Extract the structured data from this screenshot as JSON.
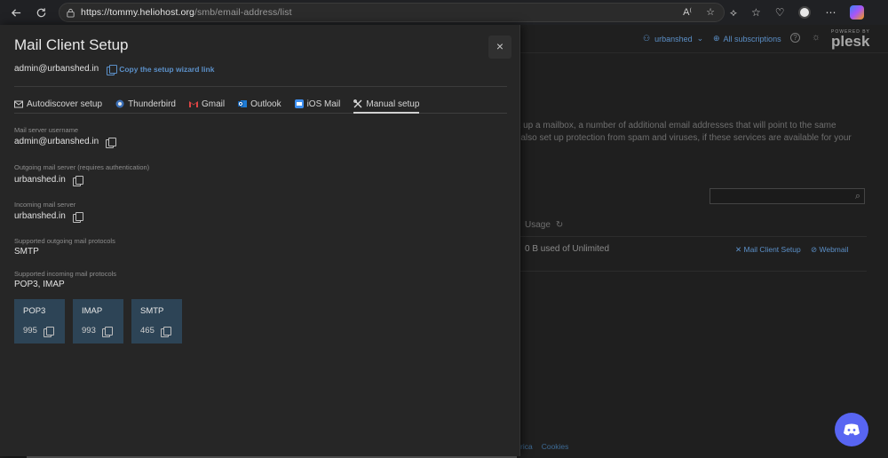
{
  "browser": {
    "url_host": "https://tommy.heliohost.org",
    "url_path": "/smb/email-address/list"
  },
  "plesk": {
    "user": "urbanshed",
    "subscriptions": "All subscriptions",
    "powered_by": "POWERED BY",
    "logo": "plesk",
    "description_line1": "et up a mailbox, a number of additional email addresses that will point to the same",
    "description_line2": "n also set up protection from spam and viruses, if these services are available for your",
    "usage_header": "Usage",
    "usage_value": "0 B used of Unlimited",
    "mail_client_setup": "Mail Client Setup",
    "webmail": "Webmail",
    "footer_a": "rica",
    "footer_b": "Cookies"
  },
  "modal": {
    "title": "Mail Client Setup",
    "close": "×",
    "account": "admin@urbanshed.in",
    "copy_wizard_link": "Copy the setup wizard link",
    "tabs": [
      {
        "label": "Autodiscover setup",
        "icon": "envelope-icon"
      },
      {
        "label": "Thunderbird",
        "icon": "thunderbird-icon"
      },
      {
        "label": "Gmail",
        "icon": "gmail-icon"
      },
      {
        "label": "Outlook",
        "icon": "outlook-icon"
      },
      {
        "label": "iOS Mail",
        "icon": "ios-mail-icon"
      },
      {
        "label": "Manual setup",
        "icon": "tools-icon",
        "active": true
      }
    ],
    "fields": {
      "username_label": "Mail server username",
      "username": "admin@urbanshed.in",
      "outgoing_label": "Outgoing mail server (requires authentication)",
      "outgoing": "urbanshed.in",
      "incoming_label": "Incoming mail server",
      "incoming": "urbanshed.in",
      "out_proto_label": "Supported outgoing mail protocols",
      "out_proto": "SMTP",
      "in_proto_label": "Supported incoming mail protocols",
      "in_proto": "POP3, IMAP"
    },
    "ports": [
      {
        "name": "POP3",
        "port": "995"
      },
      {
        "name": "IMAP",
        "port": "993"
      },
      {
        "name": "SMTP",
        "port": "465"
      }
    ]
  }
}
